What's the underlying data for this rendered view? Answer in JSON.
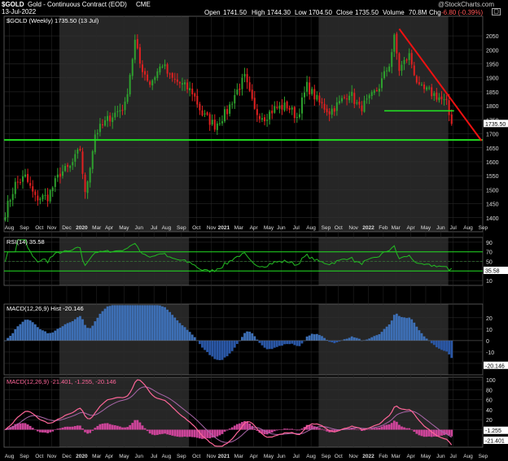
{
  "header": {
    "symbol": "$GOLD",
    "name": "Gold - Continuous Contract (EOD)",
    "exchange": "CME",
    "date": "13-Jul-2022",
    "open_label": "Open",
    "open": "1741.50",
    "high_label": "High",
    "high": "1744.30",
    "low_label": "Low",
    "low": "1704.50",
    "close_label": "Close",
    "close": "1735.50",
    "volume_label": "Volume",
    "volume": "70.8M",
    "chg_label": "Chg",
    "chg": "-6.80 (-0.39%)",
    "copyright": "@StockCharts.com"
  },
  "colors": {
    "background": "#000000",
    "shade": "#262626",
    "up": "#2ea12e",
    "down": "#e02020",
    "support": "#22dd22",
    "trend": "#ee1111",
    "rsi": "#22bb22",
    "macd_hist_pos": "#3d6fb5",
    "macd_hist_neg": "#2a57a6",
    "macd_line": "#ff6699",
    "macd_signal": "#aa66aa",
    "macd_hist2": "#cc4499"
  },
  "chart_data": [
    {
      "type": "candlestick",
      "legend": "$GOLD (Weekly) 1735.50 (13 Jul)",
      "ylim": [
        1350,
        2120
      ],
      "yticks": [
        1400,
        1450,
        1500,
        1550,
        1600,
        1650,
        1700,
        1750,
        1800,
        1850,
        1900,
        1950,
        2000,
        2050
      ],
      "x_labels": [
        "Aug",
        "Sep",
        "Oct",
        "Nov",
        "Dec",
        "2020",
        "Mar",
        "Apr",
        "May",
        "Jun",
        "Jul",
        "Aug",
        "Sep",
        "Oct",
        "Nov",
        "2021",
        "Mar",
        "Apr",
        "May",
        "Jun",
        "Jul",
        "Aug",
        "Sep",
        "Oct",
        "Nov",
        "2022",
        "Feb",
        "Mar",
        "Apr",
        "May",
        "Jun",
        "Jul",
        "Aug",
        "Sep"
      ],
      "last_value_label": "1735.50",
      "anchors": [
        {
          "week": 0,
          "close": 1420
        },
        {
          "week": 4,
          "close": 1520
        },
        {
          "week": 8,
          "close": 1545
        },
        {
          "week": 12,
          "close": 1470
        },
        {
          "week": 17,
          "close": 1475
        },
        {
          "week": 22,
          "close": 1560
        },
        {
          "week": 26,
          "close": 1580
        },
        {
          "week": 30,
          "close": 1645
        },
        {
          "week": 32,
          "close": 1480
        },
        {
          "week": 36,
          "close": 1700
        },
        {
          "week": 42,
          "close": 1760
        },
        {
          "week": 48,
          "close": 1800
        },
        {
          "week": 52,
          "close": 2030
        },
        {
          "week": 54,
          "close": 1950
        },
        {
          "week": 58,
          "close": 1880
        },
        {
          "week": 63,
          "close": 1950
        },
        {
          "week": 66,
          "close": 1900
        },
        {
          "week": 70,
          "close": 1880
        },
        {
          "week": 75,
          "close": 1850
        },
        {
          "week": 79,
          "close": 1770
        },
        {
          "week": 84,
          "close": 1730
        },
        {
          "week": 89,
          "close": 1780
        },
        {
          "week": 92,
          "close": 1840
        },
        {
          "week": 96,
          "close": 1900
        },
        {
          "week": 100,
          "close": 1780
        },
        {
          "week": 104,
          "close": 1760
        },
        {
          "week": 108,
          "close": 1790
        },
        {
          "week": 113,
          "close": 1800
        },
        {
          "week": 117,
          "close": 1760
        },
        {
          "week": 121,
          "close": 1870
        },
        {
          "week": 126,
          "close": 1810
        },
        {
          "week": 130,
          "close": 1780
        },
        {
          "week": 134,
          "close": 1810
        },
        {
          "week": 138,
          "close": 1850
        },
        {
          "week": 142,
          "close": 1790
        },
        {
          "week": 146,
          "close": 1820
        },
        {
          "week": 150,
          "close": 1870
        },
        {
          "week": 154,
          "close": 1950
        },
        {
          "week": 156,
          "close": 2040
        },
        {
          "week": 158,
          "close": 1930
        },
        {
          "week": 162,
          "close": 1980
        },
        {
          "week": 166,
          "close": 1860
        },
        {
          "week": 170,
          "close": 1850
        },
        {
          "week": 174,
          "close": 1830
        },
        {
          "week": 177,
          "close": 1805
        },
        {
          "week": 179,
          "close": 1730
        }
      ],
      "support_line": 1678,
      "neckline": 1782,
      "trendline": [
        {
          "week": 158,
          "value": 2075
        },
        {
          "week": 191,
          "value": 1675
        }
      ]
    },
    {
      "type": "line",
      "title": "RSI(14) 35.58",
      "ylim": [
        0,
        100
      ],
      "yticks": [
        10,
        30,
        50,
        70,
        90
      ],
      "bands": [
        30,
        50,
        70
      ],
      "last_value_label": "35.58"
    },
    {
      "type": "bar",
      "title": "MACD(12,26,9) Hist -20.146",
      "ylim": [
        -30,
        32
      ],
      "yticks": [
        -20,
        -10,
        0,
        10,
        20
      ],
      "last_value_label": "-20.146"
    },
    {
      "type": "line",
      "title": "MACD(12,26,9) -21.401, -1.255, -20.146",
      "ylim": [
        -35,
        105
      ],
      "yticks": [
        0,
        20,
        40,
        60,
        80,
        100
      ],
      "series": [
        {
          "name": "MACD",
          "last": "-21.401"
        },
        {
          "name": "Signal",
          "last": "-1.255"
        },
        {
          "name": "Hist",
          "last": "-20.146"
        }
      ]
    }
  ]
}
